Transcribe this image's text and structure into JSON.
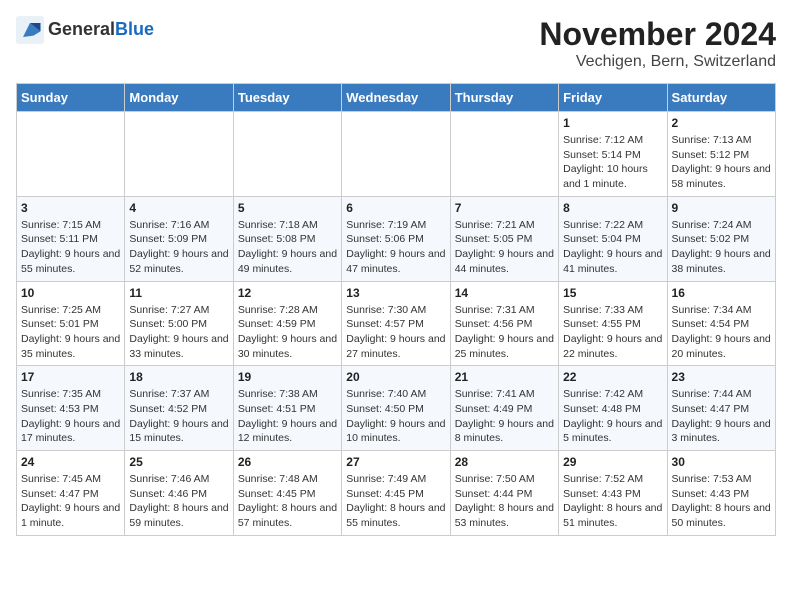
{
  "logo": {
    "general": "General",
    "blue": "Blue"
  },
  "title": "November 2024",
  "subtitle": "Vechigen, Bern, Switzerland",
  "weekdays": [
    "Sunday",
    "Monday",
    "Tuesday",
    "Wednesday",
    "Thursday",
    "Friday",
    "Saturday"
  ],
  "weeks": [
    [
      {
        "day": "",
        "info": ""
      },
      {
        "day": "",
        "info": ""
      },
      {
        "day": "",
        "info": ""
      },
      {
        "day": "",
        "info": ""
      },
      {
        "day": "",
        "info": ""
      },
      {
        "day": "1",
        "info": "Sunrise: 7:12 AM\nSunset: 5:14 PM\nDaylight: 10 hours and 1 minute."
      },
      {
        "day": "2",
        "info": "Sunrise: 7:13 AM\nSunset: 5:12 PM\nDaylight: 9 hours and 58 minutes."
      }
    ],
    [
      {
        "day": "3",
        "info": "Sunrise: 7:15 AM\nSunset: 5:11 PM\nDaylight: 9 hours and 55 minutes."
      },
      {
        "day": "4",
        "info": "Sunrise: 7:16 AM\nSunset: 5:09 PM\nDaylight: 9 hours and 52 minutes."
      },
      {
        "day": "5",
        "info": "Sunrise: 7:18 AM\nSunset: 5:08 PM\nDaylight: 9 hours and 49 minutes."
      },
      {
        "day": "6",
        "info": "Sunrise: 7:19 AM\nSunset: 5:06 PM\nDaylight: 9 hours and 47 minutes."
      },
      {
        "day": "7",
        "info": "Sunrise: 7:21 AM\nSunset: 5:05 PM\nDaylight: 9 hours and 44 minutes."
      },
      {
        "day": "8",
        "info": "Sunrise: 7:22 AM\nSunset: 5:04 PM\nDaylight: 9 hours and 41 minutes."
      },
      {
        "day": "9",
        "info": "Sunrise: 7:24 AM\nSunset: 5:02 PM\nDaylight: 9 hours and 38 minutes."
      }
    ],
    [
      {
        "day": "10",
        "info": "Sunrise: 7:25 AM\nSunset: 5:01 PM\nDaylight: 9 hours and 35 minutes."
      },
      {
        "day": "11",
        "info": "Sunrise: 7:27 AM\nSunset: 5:00 PM\nDaylight: 9 hours and 33 minutes."
      },
      {
        "day": "12",
        "info": "Sunrise: 7:28 AM\nSunset: 4:59 PM\nDaylight: 9 hours and 30 minutes."
      },
      {
        "day": "13",
        "info": "Sunrise: 7:30 AM\nSunset: 4:57 PM\nDaylight: 9 hours and 27 minutes."
      },
      {
        "day": "14",
        "info": "Sunrise: 7:31 AM\nSunset: 4:56 PM\nDaylight: 9 hours and 25 minutes."
      },
      {
        "day": "15",
        "info": "Sunrise: 7:33 AM\nSunset: 4:55 PM\nDaylight: 9 hours and 22 minutes."
      },
      {
        "day": "16",
        "info": "Sunrise: 7:34 AM\nSunset: 4:54 PM\nDaylight: 9 hours and 20 minutes."
      }
    ],
    [
      {
        "day": "17",
        "info": "Sunrise: 7:35 AM\nSunset: 4:53 PM\nDaylight: 9 hours and 17 minutes."
      },
      {
        "day": "18",
        "info": "Sunrise: 7:37 AM\nSunset: 4:52 PM\nDaylight: 9 hours and 15 minutes."
      },
      {
        "day": "19",
        "info": "Sunrise: 7:38 AM\nSunset: 4:51 PM\nDaylight: 9 hours and 12 minutes."
      },
      {
        "day": "20",
        "info": "Sunrise: 7:40 AM\nSunset: 4:50 PM\nDaylight: 9 hours and 10 minutes."
      },
      {
        "day": "21",
        "info": "Sunrise: 7:41 AM\nSunset: 4:49 PM\nDaylight: 9 hours and 8 minutes."
      },
      {
        "day": "22",
        "info": "Sunrise: 7:42 AM\nSunset: 4:48 PM\nDaylight: 9 hours and 5 minutes."
      },
      {
        "day": "23",
        "info": "Sunrise: 7:44 AM\nSunset: 4:47 PM\nDaylight: 9 hours and 3 minutes."
      }
    ],
    [
      {
        "day": "24",
        "info": "Sunrise: 7:45 AM\nSunset: 4:47 PM\nDaylight: 9 hours and 1 minute."
      },
      {
        "day": "25",
        "info": "Sunrise: 7:46 AM\nSunset: 4:46 PM\nDaylight: 8 hours and 59 minutes."
      },
      {
        "day": "26",
        "info": "Sunrise: 7:48 AM\nSunset: 4:45 PM\nDaylight: 8 hours and 57 minutes."
      },
      {
        "day": "27",
        "info": "Sunrise: 7:49 AM\nSunset: 4:45 PM\nDaylight: 8 hours and 55 minutes."
      },
      {
        "day": "28",
        "info": "Sunrise: 7:50 AM\nSunset: 4:44 PM\nDaylight: 8 hours and 53 minutes."
      },
      {
        "day": "29",
        "info": "Sunrise: 7:52 AM\nSunset: 4:43 PM\nDaylight: 8 hours and 51 minutes."
      },
      {
        "day": "30",
        "info": "Sunrise: 7:53 AM\nSunset: 4:43 PM\nDaylight: 8 hours and 50 minutes."
      }
    ]
  ]
}
